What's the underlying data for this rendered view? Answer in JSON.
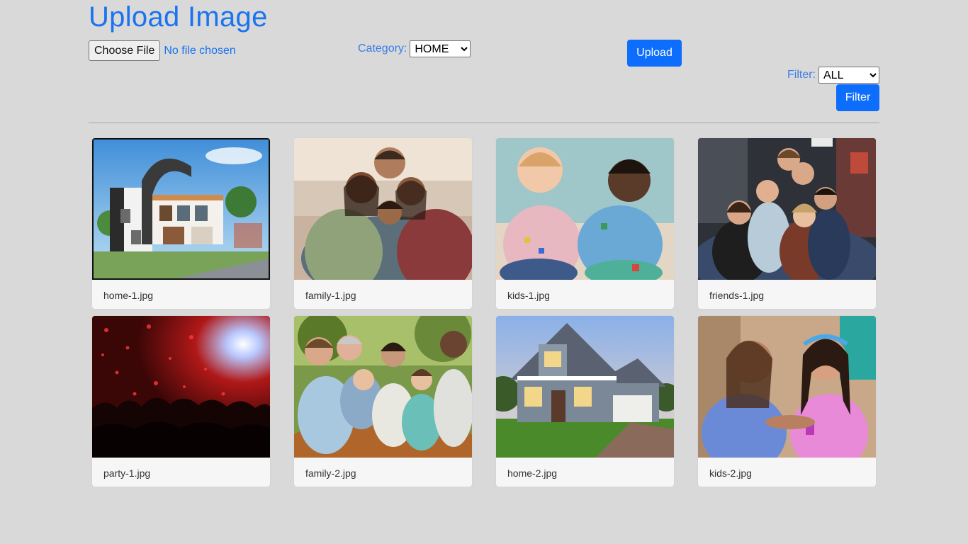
{
  "header": {
    "title": "Upload Image"
  },
  "upload": {
    "choose_file_label": "Choose File",
    "file_status": "No file chosen",
    "category_label": "Category:",
    "category_selected": "HOME",
    "upload_label": "Upload"
  },
  "filter": {
    "label": "Filter:",
    "selected": "ALL",
    "button_label": "Filter"
  },
  "gallery": {
    "items": [
      {
        "caption": "home-1.jpg",
        "icon": "house-photo",
        "selected": true
      },
      {
        "caption": "family-1.jpg",
        "icon": "family-photo"
      },
      {
        "caption": "kids-1.jpg",
        "icon": "kids-photo"
      },
      {
        "caption": "friends-1.jpg",
        "icon": "friends-photo"
      },
      {
        "caption": "party-1.jpg",
        "icon": "concert-photo"
      },
      {
        "caption": "family-2.jpg",
        "icon": "family-photo"
      },
      {
        "caption": "home-2.jpg",
        "icon": "house-photo"
      },
      {
        "caption": "kids-2.jpg",
        "icon": "kids-photo"
      }
    ]
  },
  "colors": {
    "background": "#d9d9d9",
    "accent": "#0d6efd",
    "title": "#1a73f0"
  }
}
